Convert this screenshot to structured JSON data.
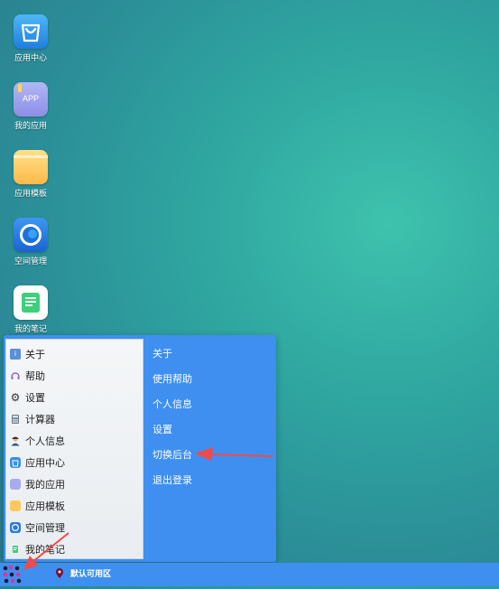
{
  "desktop": {
    "icons": [
      {
        "label": "应用中心",
        "icon": "shopping-bag-icon"
      },
      {
        "label": "我的应用",
        "icon": "app-icon",
        "badge": "APP"
      },
      {
        "label": "应用模板",
        "icon": "folder-icon"
      },
      {
        "label": "空间管理",
        "icon": "circle-swirl-icon"
      },
      {
        "label": "我的笔记",
        "icon": "note-icon"
      }
    ]
  },
  "start_menu": {
    "left_items": [
      {
        "label": "关于",
        "icon": "info-icon"
      },
      {
        "label": "帮助",
        "icon": "headset-icon"
      },
      {
        "label": "设置",
        "icon": "gear-icon"
      },
      {
        "label": "计算器",
        "icon": "calculator-icon"
      },
      {
        "label": "个人信息",
        "icon": "user-icon"
      },
      {
        "label": "应用中心",
        "icon": "shopping-bag-icon"
      },
      {
        "label": "我的应用",
        "icon": "app-icon"
      },
      {
        "label": "应用模板",
        "icon": "folder-icon"
      },
      {
        "label": "空间管理",
        "icon": "circle-swirl-icon"
      },
      {
        "label": "我的笔记",
        "icon": "note-icon"
      }
    ],
    "right_items": [
      {
        "label": "关于"
      },
      {
        "label": "使用帮助"
      },
      {
        "label": "个人信息"
      },
      {
        "label": "设置"
      },
      {
        "label": "切换后台"
      },
      {
        "label": "退出登录"
      }
    ]
  },
  "taskbar": {
    "region_label": "默认可用区"
  },
  "colors": {
    "taskbar": "#3e8ff0",
    "menu_panel": "#3e8ff0",
    "annotation_arrow": "#f04a4a"
  }
}
